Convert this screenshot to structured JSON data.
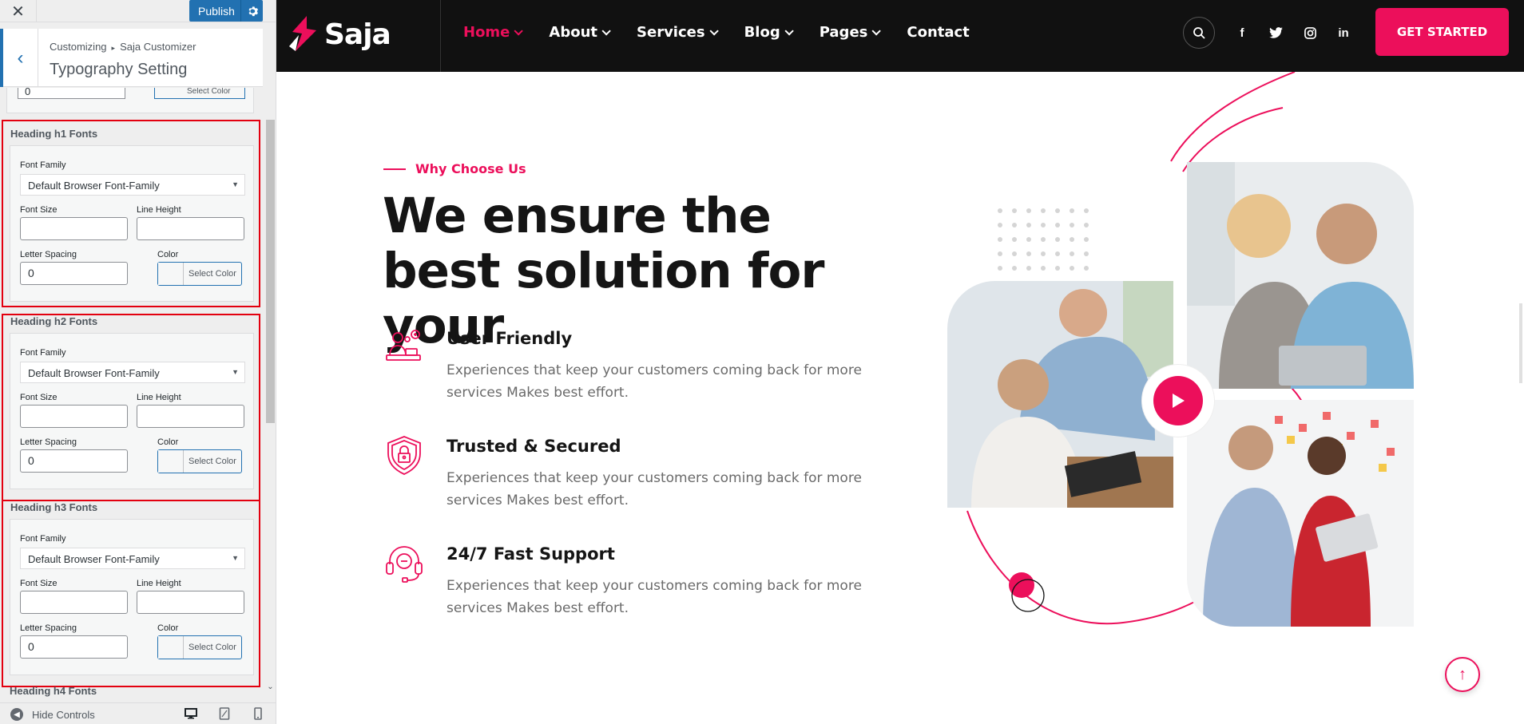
{
  "panel": {
    "close_icon": "close-icon",
    "publish_label": "Publish",
    "breadcrumb": {
      "root": "Customizing",
      "child": "Saja Customizer"
    },
    "section_title": "Typography Setting",
    "top_stub": {
      "value": "0",
      "color_label": "Select Color"
    },
    "groups": [
      {
        "title": "Heading h1 Fonts",
        "font_family_label": "Font Family",
        "font_family_value": "Default Browser Font-Family",
        "font_size_label": "Font Size",
        "font_size_value": "",
        "line_height_label": "Line Height",
        "line_height_value": "",
        "letter_spacing_label": "Letter Spacing",
        "letter_spacing_value": "0",
        "color_label": "Color",
        "color_button": "Select Color"
      },
      {
        "title": "Heading h2 Fonts",
        "font_family_label": "Font Family",
        "font_family_value": "Default Browser Font-Family",
        "font_size_label": "Font Size",
        "font_size_value": "",
        "line_height_label": "Line Height",
        "line_height_value": "",
        "letter_spacing_label": "Letter Spacing",
        "letter_spacing_value": "0",
        "color_label": "Color",
        "color_button": "Select Color"
      },
      {
        "title": "Heading h3 Fonts",
        "font_family_label": "Font Family",
        "font_family_value": "Default Browser Font-Family",
        "font_size_label": "Font Size",
        "font_size_value": "",
        "line_height_label": "Line Height",
        "line_height_value": "",
        "letter_spacing_label": "Letter Spacing",
        "letter_spacing_value": "0",
        "color_label": "Color",
        "color_button": "Select Color"
      }
    ],
    "next_group_title": "Heading h4 Fonts",
    "footer": {
      "hide_controls": "Hide Controls"
    }
  },
  "site": {
    "logo_text": "Saja",
    "menu": [
      {
        "label": "Home",
        "active": true
      },
      {
        "label": "About",
        "active": false
      },
      {
        "label": "Services",
        "active": false
      },
      {
        "label": "Blog",
        "active": false
      },
      {
        "label": "Pages",
        "active": false
      },
      {
        "label": "Contact",
        "active": false
      }
    ],
    "social_icons": [
      "facebook-icon",
      "twitter-icon",
      "instagram-icon",
      "linkedin-icon"
    ],
    "cta_label": "GET STARTED",
    "eyebrow": "Why Choose Us",
    "hero_title": "We ensure the best solution for your",
    "features": [
      {
        "title": "User Friendly",
        "desc": "Experiences that keep your customers coming back for more services Makes best effort.",
        "icon": "user-friendly-icon"
      },
      {
        "title": "Trusted & Secured",
        "desc": "Experiences that keep your customers coming back for more services Makes best effort.",
        "icon": "shield-lock-icon"
      },
      {
        "title": "24/7 Fast Support",
        "desc": "Experiences that keep your customers coming back for more services Makes best effort.",
        "icon": "headset-icon"
      }
    ]
  },
  "colors": {
    "accent": "#ec0f5b",
    "wp_blue": "#2271b1",
    "highlight_border": "#e3000f",
    "nav_bg": "#111111"
  }
}
